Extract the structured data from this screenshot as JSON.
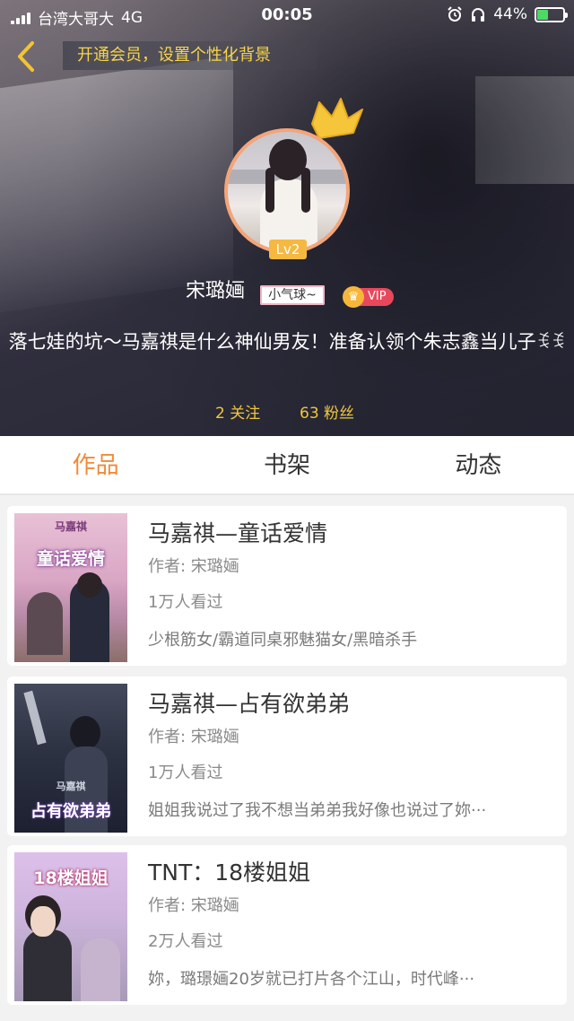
{
  "status_bar": {
    "carrier": "台湾大哥大",
    "network": "4G",
    "time": "00:05",
    "battery": "44%",
    "battery_level": 0.44,
    "icons": [
      "alarm-icon",
      "headphones-icon",
      "battery-charging-icon"
    ]
  },
  "header": {
    "back_icon": "chevron-left-icon",
    "vip_banner": "开通会员，设置个性化背景"
  },
  "profile": {
    "level": "Lv2",
    "username": "宋璐婳",
    "tag": "小气球~",
    "vip_label": "VIP",
    "bio": "落七娃的坑～马嘉祺是什么神仙男友！准备认领个朱志鑫当儿子ꉂꉂ",
    "following": "2 关注",
    "followers": "63 粉丝"
  },
  "tabs": [
    {
      "label": "作品",
      "active": true
    },
    {
      "label": "书架",
      "active": false
    },
    {
      "label": "动态",
      "active": false
    }
  ],
  "works": [
    {
      "title": "马嘉祺—童话爱情",
      "author": "作者: 宋璐婳",
      "views": "1万人看过",
      "desc": "少根筋女/霸道同桌邪魅猫女/黑暗杀手",
      "cover_text": "童话爱情",
      "cover_sub": "马嘉祺"
    },
    {
      "title": "马嘉祺—占有欲弟弟",
      "author": "作者: 宋璐婳",
      "views": "1万人看过",
      "desc": "姐姐我说过了我不想当弟弟我好像也说过了妳···",
      "cover_text": "占有欲弟弟",
      "cover_sub": "马嘉祺"
    },
    {
      "title": "TNT：18楼姐姐",
      "author": "作者: 宋璐婳",
      "views": "2万人看过",
      "desc": "妳，璐璟婳20岁就已打片各个江山，时代峰···",
      "cover_text": "18楼姐姐",
      "cover_sub": ""
    }
  ],
  "colors": {
    "accent": "#f08b3a",
    "gold": "#f1c63c",
    "vip_red": "#e9485c"
  }
}
